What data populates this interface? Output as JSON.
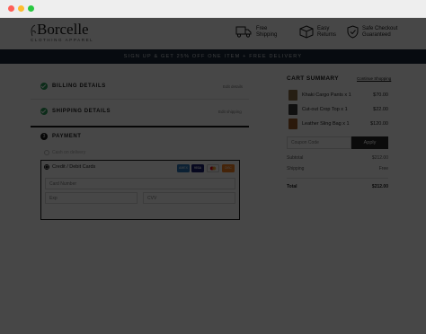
{
  "window": {
    "controls": [
      "close",
      "minimize",
      "maximize"
    ]
  },
  "brand": {
    "name": "Borcelle",
    "tagline": "CLOTHING APPAREL"
  },
  "features": [
    {
      "icon": "truck-icon",
      "line1": "Free",
      "line2": "Shipping"
    },
    {
      "icon": "box-return-icon",
      "line1": "Easy",
      "line2": "Returns"
    },
    {
      "icon": "shield-check-icon",
      "line1": "Safe Checkout",
      "line2": "Guaranteed"
    }
  ],
  "promo": {
    "text": "SIGN UP & GET 25% OFF ONE ITEM + FREE DELIVERY"
  },
  "checkout": {
    "billing": {
      "label": "BILLING DETAILS",
      "action": "Edit details"
    },
    "shipping": {
      "label": "SHIPPING DETAILS",
      "action": "Edit shipping"
    },
    "payment": {
      "step": "3",
      "label": "PAYMENT",
      "cash_option": "Cash on delivery",
      "card_option": "Credit / Debit Cards",
      "card_brands": [
        "AMEX",
        "VISA",
        "MC",
        "DISC"
      ],
      "card_number_placeholder": "Card Number",
      "exp_placeholder": "Exp",
      "cvv_placeholder": "CVV"
    }
  },
  "cart": {
    "title": "CART SUMMARY",
    "continue_link": "Continue Shopping",
    "items": [
      {
        "name": "Khaki Cargo Pants x 1",
        "price": "$70.00"
      },
      {
        "name": "Cut-out Crop Top x 1",
        "price": "$22.00"
      },
      {
        "name": "Leather Sling Bag x 1",
        "price": "$120.00"
      }
    ],
    "coupon_placeholder": "Coupon Code",
    "apply_label": "Apply",
    "subtotal_label": "Subtotal",
    "subtotal_value": "$212.00",
    "shipping_label": "Shipping",
    "shipping_value": "Free",
    "total_label": "Total",
    "total_value": "$212.00"
  },
  "colors": {
    "accent_green": "#2e9e5b",
    "promo_bar": "#1b2a3b",
    "overlay": "rgba(0,0,0,0.72)",
    "amex": "#2e77bb",
    "visa": "#1a1f71"
  }
}
